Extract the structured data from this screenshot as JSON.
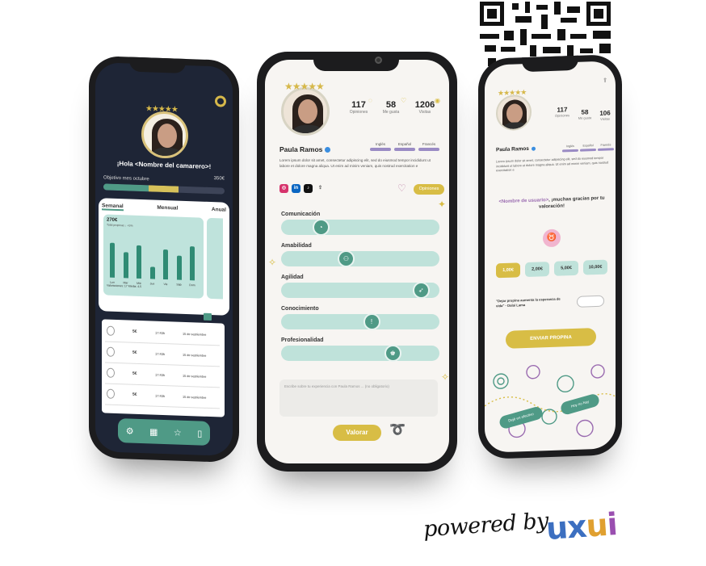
{
  "left_phone": {
    "greeting": "¡Hola <Nombre del camarero>!",
    "goal_label": "Objetivo mes octubre",
    "goal_value": "350€",
    "goal_progress": 0.62,
    "tabs": [
      "Semanal",
      "Mensual",
      "Anual"
    ],
    "earnings": "270€",
    "earnings_sub": "Total propinas ↓ +5%",
    "days": [
      "Lun",
      "Mar",
      "Mié",
      "Jue",
      "Vie",
      "Sáb",
      "Dom"
    ],
    "bar_values": [
      0.82,
      0.62,
      0.78,
      0.28,
      0.72,
      0.58,
      0.8
    ],
    "footer_stats": "Valoraciones: 17     Media: 4,5",
    "rows": [
      {
        "amount": "5€",
        "time": "17:43h",
        "date": "15 de septiembre"
      },
      {
        "amount": "5€",
        "time": "17:43h",
        "date": "15 de septiembre"
      },
      {
        "amount": "5€",
        "time": "17:43h",
        "date": "15 de septiembre"
      },
      {
        "amount": "5€",
        "time": "17:43h",
        "date": "15 de septiembre"
      }
    ],
    "nav_icons": [
      "gear-icon",
      "qr-icon",
      "star-icon",
      "phone-icon"
    ]
  },
  "center_phone": {
    "stats": [
      {
        "number": "117",
        "label": "Opiniones"
      },
      {
        "number": "58",
        "label": "Me gusta"
      },
      {
        "number": "1206",
        "label": "Visitas"
      }
    ],
    "name": "Paula Ramos",
    "languages": [
      "Inglés",
      "Español",
      "Francés"
    ],
    "bio": "Lorem ipsum dolor sit amet, consectetur adipiscing elit, sed do eiusmod tempor incididunt ut labore et dolore magna aliqua. Ut enim ad minim veniam, quis nostrud exercitation e",
    "opinions_button": "Opiniones",
    "sliders": [
      {
        "label": "Comunicación",
        "value": 0.22
      },
      {
        "label": "Amabilidad",
        "value": 0.4
      },
      {
        "label": "Agilidad",
        "value": 0.93
      },
      {
        "label": "Conocimiento",
        "value": 0.58
      },
      {
        "label": "Profesionalidad",
        "value": 0.73
      }
    ],
    "comment_placeholder": "Escribe sobre tu experiencia con Paula Ramos ... (no obligatorio)",
    "submit_button": "Valorar"
  },
  "right_phone": {
    "stats": [
      {
        "number": "117",
        "label": "Opiniones"
      },
      {
        "number": "58",
        "label": "Me gusta"
      },
      {
        "number": "106",
        "label": "Visitas"
      }
    ],
    "name": "Paula Ramos",
    "languages": [
      "Inglés",
      "Español",
      "Francés"
    ],
    "bio": "Lorem ipsum dolor sit amet, consectetur adipiscing elit, sed do eiusmod tempor incididunt ut labore et dolore magna aliqua. Ut enim ad minim veniam, quis nostrud exercitation e",
    "thanks_highlight": "<Nombre de usuario>",
    "thanks_rest": ", ¡muchas gracias por tu valoración!",
    "amounts": [
      "1,00€",
      "2,00€",
      "5,00€",
      "10,00€"
    ],
    "quote": "\"Dejar propina aumenta la esperanza de vida\" - Dalai Lama",
    "send_button": "ENVIAR PROPINA",
    "cash_button": "Dejé en efectivo",
    "none_button": "Hoy no hay"
  },
  "branding": {
    "powered_by": "powered by",
    "logo_text": "uxui"
  }
}
